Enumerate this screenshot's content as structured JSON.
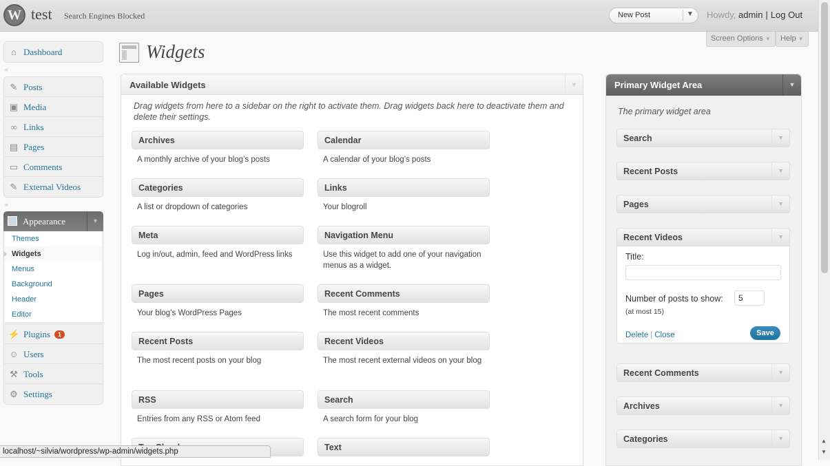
{
  "header": {
    "site_title": "test",
    "privacy_note": "Search Engines Blocked",
    "new_post_label": "New Post",
    "howdy": "Howdy,",
    "username": "admin",
    "logout": "Log Out"
  },
  "meta_links": {
    "screen_options": "Screen Options",
    "help": "Help"
  },
  "menu": {
    "dashboard": "Dashboard",
    "group1": [
      "Posts",
      "Media",
      "Links",
      "Pages",
      "Comments",
      "External Videos"
    ],
    "appearance": "Appearance",
    "appearance_sub": [
      "Themes",
      "Widgets",
      "Menus",
      "Background",
      "Header",
      "Editor"
    ],
    "group3": [
      "Plugins",
      "Users",
      "Tools",
      "Settings"
    ],
    "plugins_badge": "1"
  },
  "page_title": "Widgets",
  "available": {
    "title": "Available Widgets",
    "description": "Drag widgets from here to a sidebar on the right to activate them. Drag widgets back here to deactivate them and delete their settings.",
    "widgets": [
      {
        "name": "Archives",
        "desc": "A monthly archive of your blog’s posts"
      },
      {
        "name": "Calendar",
        "desc": "A calendar of your blog’s posts"
      },
      {
        "name": "Categories",
        "desc": "A list or dropdown of categories"
      },
      {
        "name": "Links",
        "desc": "Your blogroll"
      },
      {
        "name": "Meta",
        "desc": "Log in/out, admin, feed and WordPress links"
      },
      {
        "name": "Navigation Menu",
        "desc": "Use this widget to add one of your navigation menus as a widget."
      },
      {
        "name": "Pages",
        "desc": "Your blog’s WordPress Pages"
      },
      {
        "name": "Recent Comments",
        "desc": "The most recent comments"
      },
      {
        "name": "Recent Posts",
        "desc": "The most recent posts on your blog"
      },
      {
        "name": "Recent Videos",
        "desc": "The most recent external videos on your blog"
      },
      {
        "name": "RSS",
        "desc": "Entries from any RSS or Atom feed"
      },
      {
        "name": "Search",
        "desc": "A search form for your blog"
      },
      {
        "name": "Tag Cloud",
        "desc": ""
      },
      {
        "name": "Text",
        "desc": ""
      }
    ]
  },
  "sidebar": {
    "title": "Primary Widget Area",
    "description": "The primary widget area",
    "widgets": [
      "Search",
      "Recent Posts",
      "Pages",
      "Recent Videos",
      "Recent Comments",
      "Archives",
      "Categories"
    ],
    "recent_videos_form": {
      "title_label": "Title:",
      "title_value": "",
      "number_label": "Number of posts to show:",
      "number_value": "5",
      "hint": "(at most 15)",
      "delete": "Delete",
      "close": "Close",
      "save": "Save"
    }
  },
  "status_bar": "localhost/~silvia/wordpress/wp-admin/widgets.php",
  "colors": {
    "link": "#21759b",
    "badge": "#d54e21",
    "save_button": "#21759b"
  }
}
